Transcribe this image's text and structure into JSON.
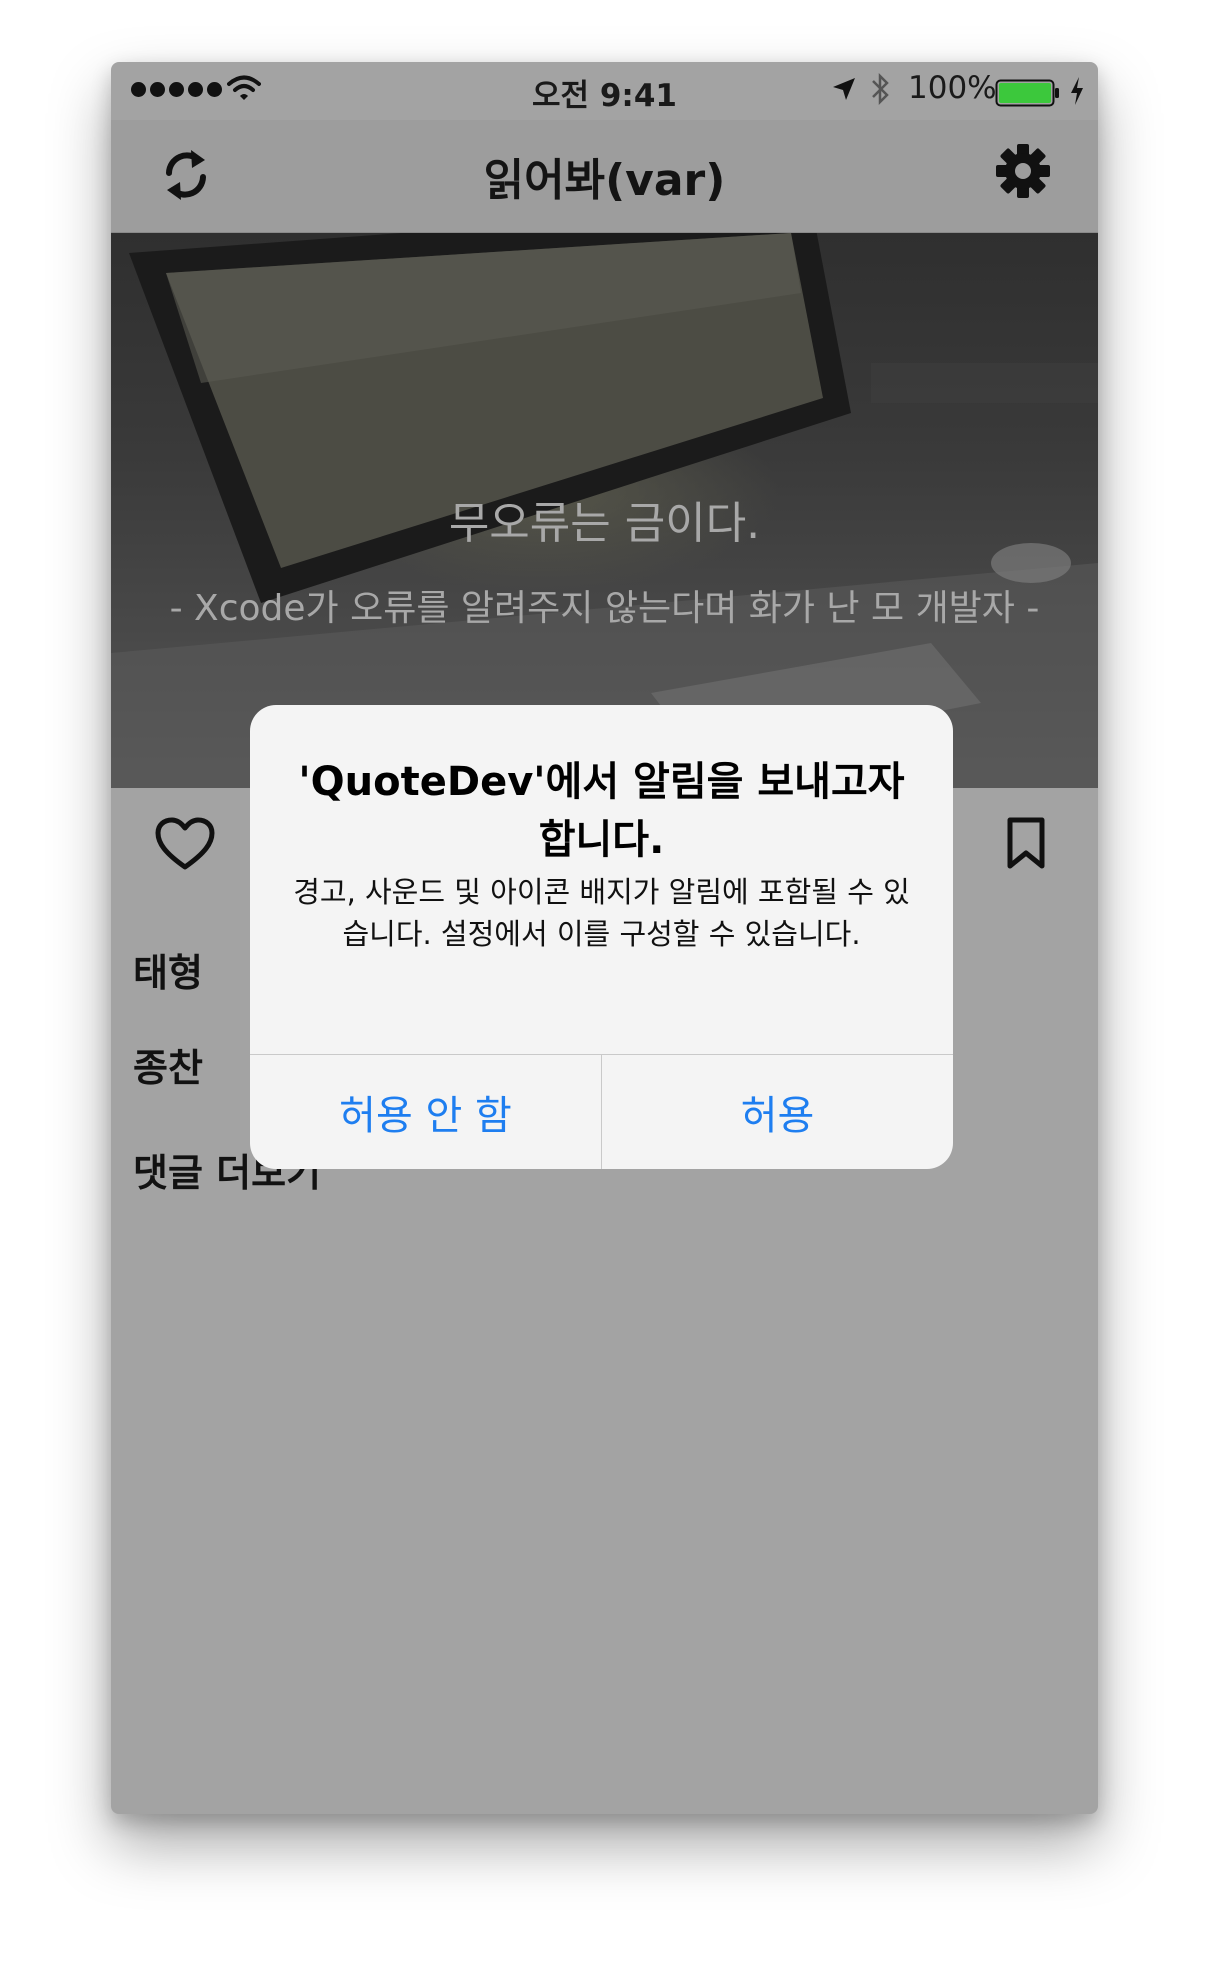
{
  "status_bar": {
    "time": "오전 9:41",
    "battery_percent": "100%",
    "signal_bars": 5,
    "battery_level": 1.0,
    "battery_color": "#3cc83c"
  },
  "nav": {
    "title": "읽어봐(var)",
    "left_icon": "refresh-icon",
    "right_icon": "settings-icon"
  },
  "hero": {
    "quote": "무오류는 금이다.",
    "author": "- Xcode가 오류를 알려주지 않는다며 화가 난 모 개발자 -"
  },
  "content": {
    "like_icon": "heart-icon",
    "bookmark_icon": "bookmark-icon",
    "line1": "태형",
    "line2": "종찬",
    "line3": "댓글 더보기"
  },
  "alert": {
    "title": "'QuoteDev'에서 알림을 보내고자 합니다.",
    "message": "경고, 사운드 및 아이콘 배지가 알림에 포함될 수 있습니다. 설정에서 이를 구성할 수 있습니다.",
    "deny_label": "허용 안 함",
    "allow_label": "허용",
    "button_color": "#1e7ef0"
  }
}
